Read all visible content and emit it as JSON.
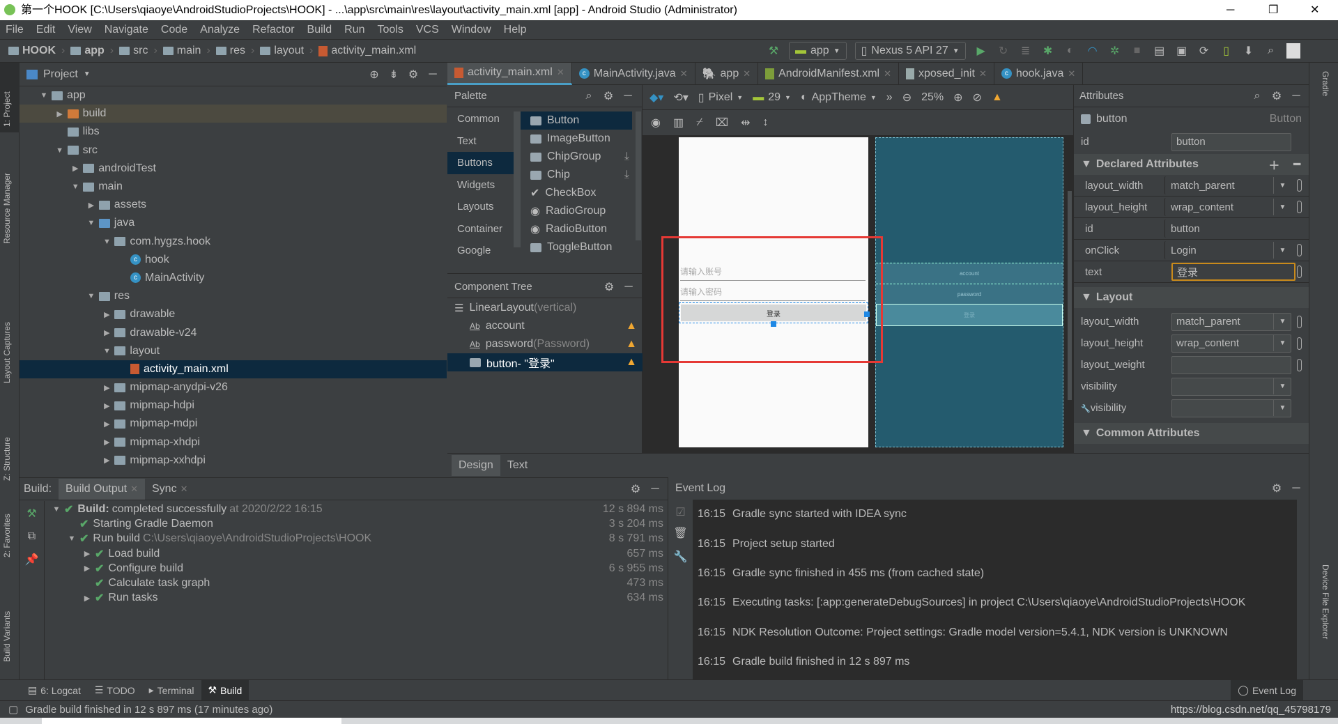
{
  "window": {
    "title": "第一个HOOK [C:\\Users\\qiaoye\\AndroidStudioProjects\\HOOK] - ...\\app\\src\\main\\res\\layout\\activity_main.xml [app] - Android Studio (Administrator)",
    "minimize": "─",
    "maximize": "❐",
    "close": "✕"
  },
  "menu": [
    "File",
    "Edit",
    "View",
    "Navigate",
    "Code",
    "Analyze",
    "Refactor",
    "Build",
    "Run",
    "Tools",
    "VCS",
    "Window",
    "Help"
  ],
  "breadcrumb": [
    "HOOK",
    "app",
    "src",
    "main",
    "res",
    "layout",
    "activity_main.xml"
  ],
  "toolbar": {
    "run_config": "app",
    "device": "Nexus 5 API 27"
  },
  "side_left": [
    "1: Project",
    "Resource Manager",
    "Layout Captures",
    "Z: Structure",
    "2: Favorites",
    "Build Variants"
  ],
  "side_right": [
    "Gradle",
    "Device File Explorer"
  ],
  "project": {
    "title": "Project",
    "items": [
      {
        "label": "app",
        "level": 0,
        "arrow": "▼",
        "icon": "module"
      },
      {
        "label": "build",
        "level": 1,
        "arrow": "▶",
        "icon": "folder-orange"
      },
      {
        "label": "libs",
        "level": 1,
        "arrow": "",
        "icon": "folder"
      },
      {
        "label": "src",
        "level": 1,
        "arrow": "▼",
        "icon": "folder"
      },
      {
        "label": "androidTest",
        "level": 2,
        "arrow": "▶",
        "icon": "folder"
      },
      {
        "label": "main",
        "level": 2,
        "arrow": "▼",
        "icon": "folder"
      },
      {
        "label": "assets",
        "level": 3,
        "arrow": "▶",
        "icon": "folder"
      },
      {
        "label": "java",
        "level": 3,
        "arrow": "▼",
        "icon": "folder-blue"
      },
      {
        "label": "com.hygzs.hook",
        "level": 4,
        "arrow": "▼",
        "icon": "package"
      },
      {
        "label": "hook",
        "level": 5,
        "arrow": "",
        "icon": "class"
      },
      {
        "label": "MainActivity",
        "level": 5,
        "arrow": "",
        "icon": "class"
      },
      {
        "label": "res",
        "level": 3,
        "arrow": "▼",
        "icon": "folder"
      },
      {
        "label": "drawable",
        "level": 4,
        "arrow": "▶",
        "icon": "folder"
      },
      {
        "label": "drawable-v24",
        "level": 4,
        "arrow": "▶",
        "icon": "folder"
      },
      {
        "label": "layout",
        "level": 4,
        "arrow": "▼",
        "icon": "folder"
      },
      {
        "label": "activity_main.xml",
        "level": 5,
        "arrow": "",
        "icon": "xml",
        "selected": true
      },
      {
        "label": "mipmap-anydpi-v26",
        "level": 4,
        "arrow": "▶",
        "icon": "folder"
      },
      {
        "label": "mipmap-hdpi",
        "level": 4,
        "arrow": "▶",
        "icon": "folder"
      },
      {
        "label": "mipmap-mdpi",
        "level": 4,
        "arrow": "▶",
        "icon": "folder"
      },
      {
        "label": "mipmap-xhdpi",
        "level": 4,
        "arrow": "▶",
        "icon": "folder"
      },
      {
        "label": "mipmap-xxhdpi",
        "level": 4,
        "arrow": "▶",
        "icon": "folder"
      }
    ]
  },
  "editor_tabs": [
    {
      "label": "activity_main.xml",
      "icon": "xml",
      "active": true
    },
    {
      "label": "MainActivity.java",
      "icon": "class"
    },
    {
      "label": "app",
      "icon": "gradle"
    },
    {
      "label": "AndroidManifest.xml",
      "icon": "manifest"
    },
    {
      "label": "xposed_init",
      "icon": "file"
    },
    {
      "label": "hook.java",
      "icon": "class"
    }
  ],
  "palette": {
    "title": "Palette",
    "categories": [
      "Common",
      "Text",
      "Buttons",
      "Widgets",
      "Layouts",
      "Container",
      "Google"
    ],
    "selected_category": "Buttons",
    "items": [
      {
        "label": "Button",
        "selected": true
      },
      {
        "label": "ImageButton"
      },
      {
        "label": "ChipGroup",
        "download": true
      },
      {
        "label": "Chip",
        "download": true
      },
      {
        "label": "CheckBox"
      },
      {
        "label": "RadioGroup"
      },
      {
        "label": "RadioButton"
      },
      {
        "label": "ToggleButton"
      }
    ]
  },
  "component_tree": {
    "title": "Component Tree",
    "root": "LinearLayout",
    "root_suffix": "(vertical)",
    "children": [
      {
        "label": "account",
        "suffix": ""
      },
      {
        "label": "password",
        "suffix": "(Password)"
      },
      {
        "label": "button- \"登录\"",
        "suffix": "",
        "selected": true
      }
    ]
  },
  "design_toolbar": {
    "device": "Pixel",
    "api": "29",
    "theme": "AppTheme",
    "zoom": "25%"
  },
  "preview": {
    "account_hint": "请输入账号",
    "password_hint": "请输入密码",
    "button_text": "登录",
    "blueprint_account": "account",
    "blueprint_password": "password",
    "blueprint_button": "登录"
  },
  "design_tabs": [
    "Design",
    "Text"
  ],
  "attributes": {
    "title": "Attributes",
    "component": "button",
    "component_type": "Button",
    "id_label": "id",
    "id_value": "button",
    "declared_title": "Declared Attributes",
    "declared": [
      {
        "key": "layout_width",
        "value": "match_parent",
        "dropdown": true
      },
      {
        "key": "layout_height",
        "value": "wrap_content",
        "dropdown": true
      },
      {
        "key": "id",
        "value": "button"
      },
      {
        "key": "onClick",
        "value": "Login",
        "dropdown": true
      },
      {
        "key": "text",
        "value": "登录",
        "focused": true
      }
    ],
    "layout_title": "Layout",
    "layout": [
      {
        "key": "layout_width",
        "value": "match_parent",
        "dropdown": true
      },
      {
        "key": "layout_height",
        "value": "wrap_content",
        "dropdown": true
      },
      {
        "key": "layout_weight",
        "value": ""
      },
      {
        "key": "visibility",
        "value": "",
        "dropdown": true
      },
      {
        "key": "visibility",
        "value": "",
        "dropdown": true,
        "tools": true
      }
    ],
    "common_title": "Common Attributes"
  },
  "build": {
    "label": "Build:",
    "tabs": [
      "Build Output",
      "Sync"
    ],
    "rows": [
      {
        "text": "Build:",
        "extra": "completed successfully",
        "meta": "at 2020/2/22 16:15",
        "duration": "12 s 894 ms",
        "level": 0,
        "arrow": "▼"
      },
      {
        "text": "Starting Gradle Daemon",
        "duration": "3 s 204 ms",
        "level": 1,
        "arrow": ""
      },
      {
        "text": "Run build",
        "meta": "C:\\Users\\qiaoye\\AndroidStudioProjects\\HOOK",
        "duration": "8 s 791 ms",
        "level": 1,
        "arrow": "▼"
      },
      {
        "text": "Load build",
        "duration": "657 ms",
        "level": 2,
        "arrow": "▶"
      },
      {
        "text": "Configure build",
        "duration": "6 s 955 ms",
        "level": 2,
        "arrow": "▶"
      },
      {
        "text": "Calculate task graph",
        "duration": "473 ms",
        "level": 2,
        "arrow": ""
      },
      {
        "text": "Run tasks",
        "duration": "634 ms",
        "level": 2,
        "arrow": "▶"
      }
    ]
  },
  "event_log": {
    "title": "Event Log",
    "entries": [
      {
        "time": "16:15",
        "text": "Gradle sync started with IDEA sync"
      },
      {
        "time": "16:15",
        "text": "Project setup started"
      },
      {
        "time": "16:15",
        "text": "Gradle sync finished in 455 ms (from cached state)"
      },
      {
        "time": "16:15",
        "text": "Executing tasks: [:app:generateDebugSources] in project C:\\Users\\qiaoye\\AndroidStudioProjects\\HOOK"
      },
      {
        "time": "16:15",
        "text": "NDK Resolution Outcome: Project settings: Gradle model version=5.4.1, NDK version is UNKNOWN"
      },
      {
        "time": "16:15",
        "text": "Gradle build finished in 12 s 897 ms"
      }
    ]
  },
  "tool_windows": [
    "6: Logcat",
    "TODO",
    "Terminal",
    "Build"
  ],
  "tool_active": "Build",
  "event_log_button": "Event Log",
  "status": {
    "message": "Gradle build finished in 12 s 897 ms (17 minutes ago)",
    "watermark": "https://blog.csdn.net/qq_45798179"
  },
  "colors": {
    "bg": "#3c3f41",
    "editor": "#2b2b2b",
    "selection": "#0d293e",
    "accent": "#4a9fc7",
    "success": "#59a869",
    "warning": "#f0a732",
    "highlight_box": "#e53935",
    "blueprint": "#245b6e"
  }
}
